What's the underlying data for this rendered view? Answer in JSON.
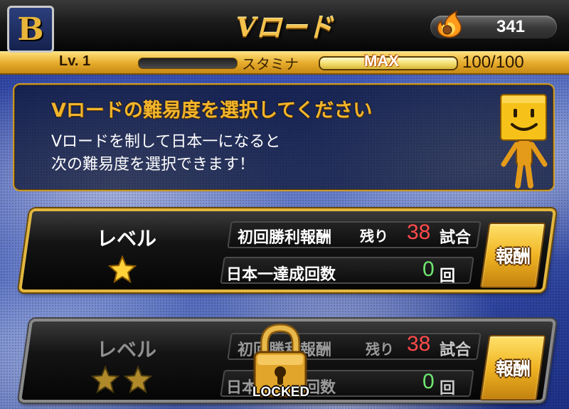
{
  "header": {
    "title": "Vロード",
    "team_logo_letter": "B",
    "coins": "341"
  },
  "status": {
    "level": "Lv. 1",
    "stamina_label": "スタミナ",
    "stamina_max_badge": "MAX",
    "stamina_value": "100/100",
    "stamina_fraction": 1.0
  },
  "info": {
    "title": "Vロードの難易度を選択してください",
    "line1": "Vロードを制して日本一になると",
    "line2": "次の難易度を選択できます！"
  },
  "levels": [
    {
      "label": "レベル",
      "stars": 1,
      "first_win_reward_label": "初回勝利報酬",
      "remaining_label": "残り",
      "remaining_count": "38",
      "games_unit": "試合",
      "champion_label": "日本一達成回数",
      "champion_count": "0",
      "times_unit": "回",
      "reward_button": "報酬",
      "locked": false
    },
    {
      "label": "レベル",
      "stars": 2,
      "first_win_reward_label": "初回勝利報酬",
      "remaining_label": "残り",
      "remaining_count": "38",
      "games_unit": "試合",
      "champion_label": "日本一達成回数",
      "champion_count": "0",
      "times_unit": "回",
      "reward_button": "報酬",
      "locked": true,
      "locked_label": "LOCKED"
    }
  ],
  "colors": {
    "gold": "#f3b52c",
    "remaining_red": "#ff4a4a",
    "count_green": "#6fe66f"
  }
}
